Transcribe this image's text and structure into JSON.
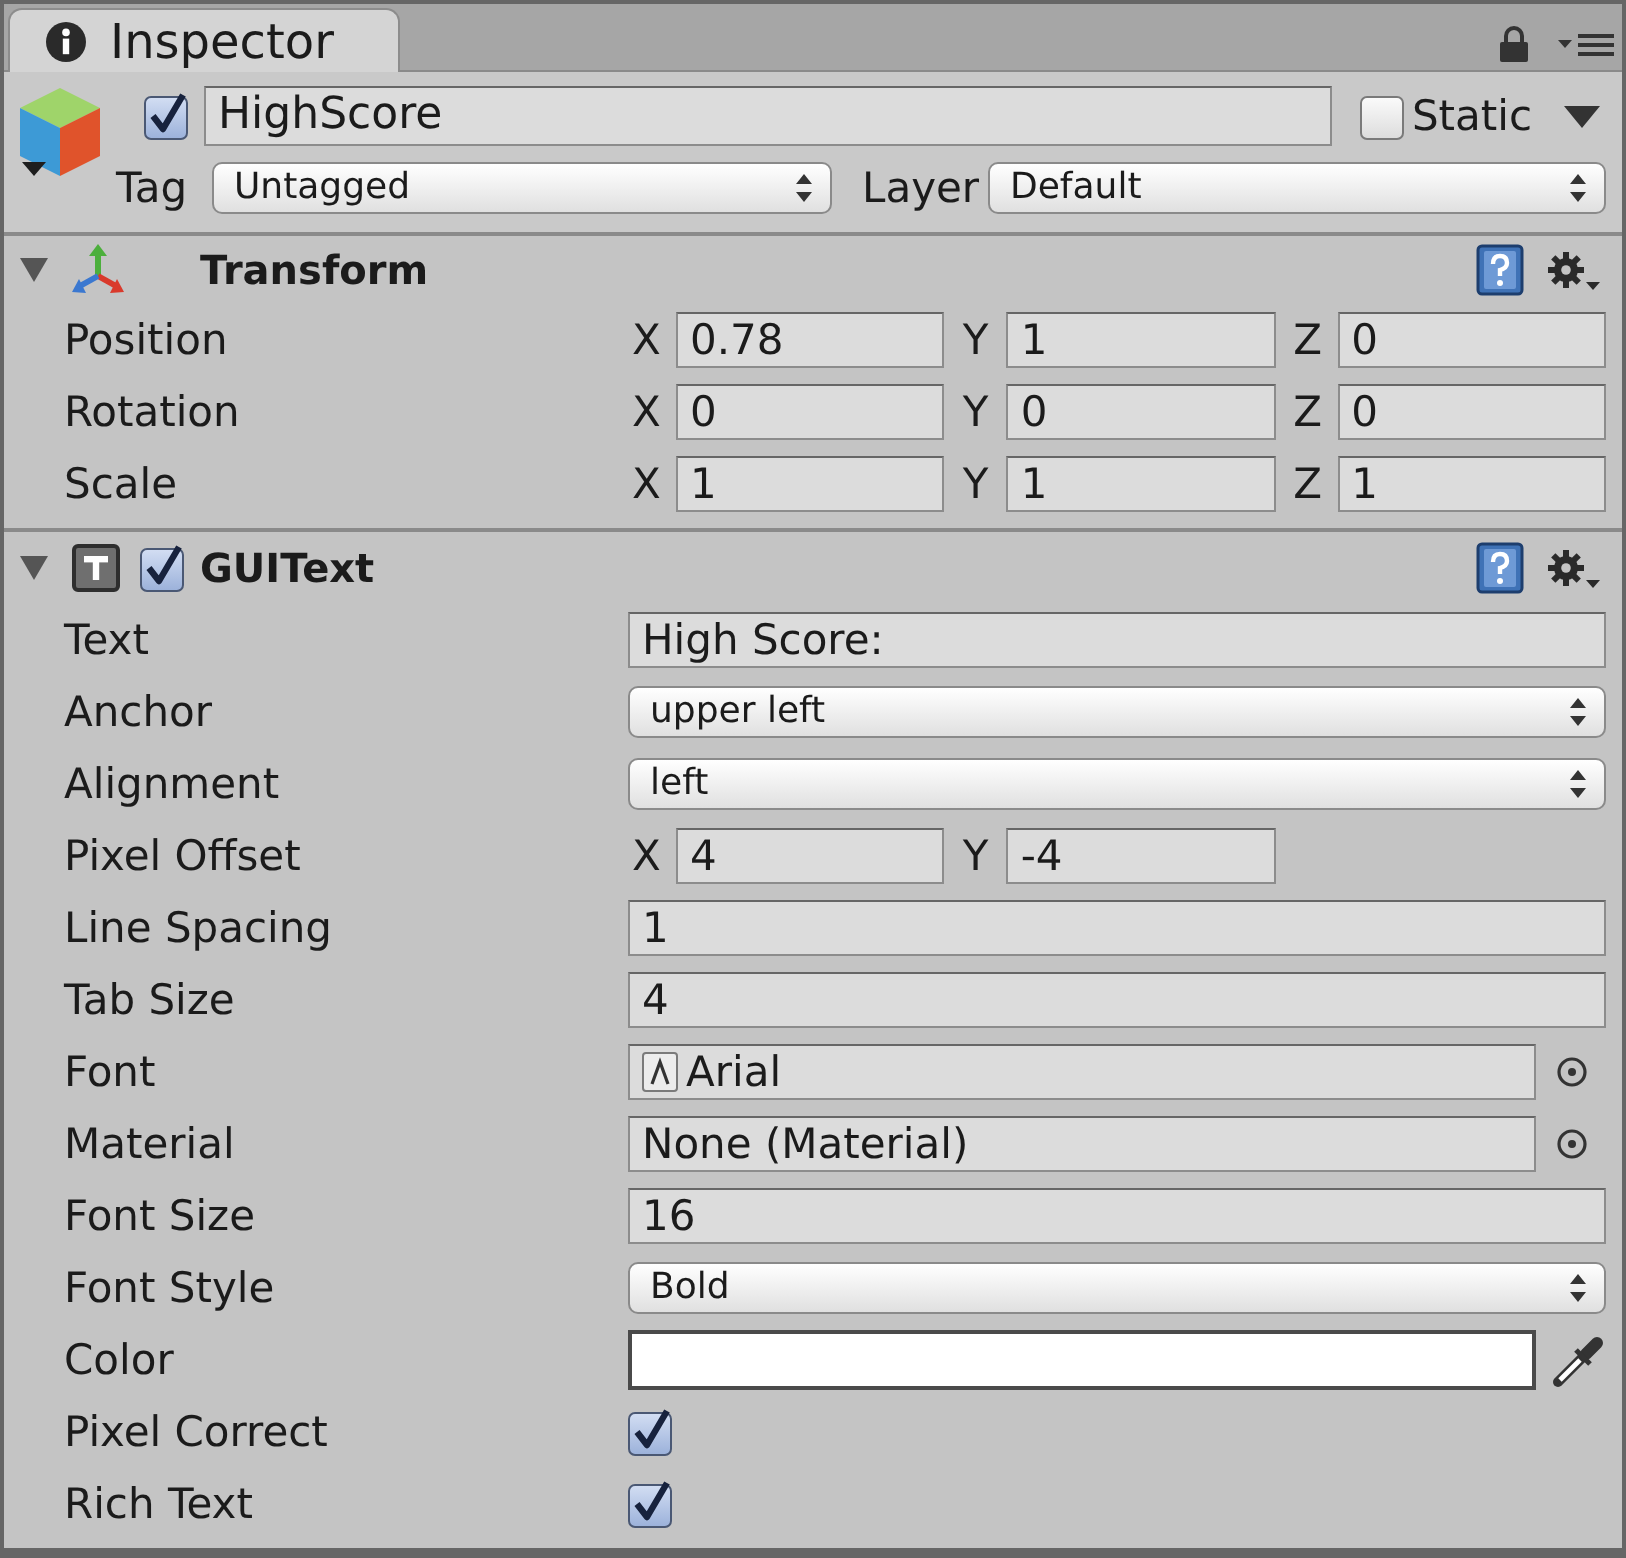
{
  "tab": {
    "title": "Inspector"
  },
  "game_object": {
    "active": true,
    "name": "HighScore",
    "static": false,
    "static_label": "Static",
    "tag_label": "Tag",
    "tag": "Untagged",
    "layer_label": "Layer",
    "layer": "Default"
  },
  "components": [
    {
      "kind": "transform",
      "title": "Transform",
      "expanded": true,
      "rows": [
        {
          "kind": "vector",
          "label": "Position",
          "fields": [
            {
              "axis": "X",
              "value": "0.78"
            },
            {
              "axis": "Y",
              "value": "1"
            },
            {
              "axis": "Z",
              "value": "0"
            }
          ]
        },
        {
          "kind": "vector",
          "label": "Rotation",
          "fields": [
            {
              "axis": "X",
              "value": "0"
            },
            {
              "axis": "Y",
              "value": "0"
            },
            {
              "axis": "Z",
              "value": "0"
            }
          ]
        },
        {
          "kind": "vector",
          "label": "Scale",
          "fields": [
            {
              "axis": "X",
              "value": "1"
            },
            {
              "axis": "Y",
              "value": "1"
            },
            {
              "axis": "Z",
              "value": "1"
            }
          ]
        }
      ]
    },
    {
      "kind": "text",
      "title": "GUIText",
      "expanded": true,
      "enabled": true,
      "rows": [
        {
          "kind": "field",
          "label": "Text",
          "value": "High Score:"
        },
        {
          "kind": "dropdown",
          "label": "Anchor",
          "value": "upper left"
        },
        {
          "kind": "dropdown",
          "label": "Alignment",
          "value": "left"
        },
        {
          "kind": "vector",
          "label": "Pixel Offset",
          "fields": [
            {
              "axis": "X",
              "value": "4"
            },
            {
              "axis": "Y",
              "value": "-4"
            }
          ]
        },
        {
          "kind": "field",
          "label": "Line Spacing",
          "value": "1"
        },
        {
          "kind": "field",
          "label": "Tab Size",
          "value": "4"
        },
        {
          "kind": "asset",
          "label": "Font",
          "value": "Arial"
        },
        {
          "kind": "object",
          "label": "Material",
          "value": "None (Material)"
        },
        {
          "kind": "field",
          "label": "Font Size",
          "value": "16"
        },
        {
          "kind": "dropdown",
          "label": "Font Style",
          "value": "Bold"
        },
        {
          "kind": "color",
          "label": "Color",
          "color": "#ffffff"
        },
        {
          "kind": "checkbox",
          "label": "Pixel Correct",
          "checked": true
        },
        {
          "kind": "checkbox",
          "label": "Rich Text",
          "checked": true
        }
      ]
    }
  ]
}
